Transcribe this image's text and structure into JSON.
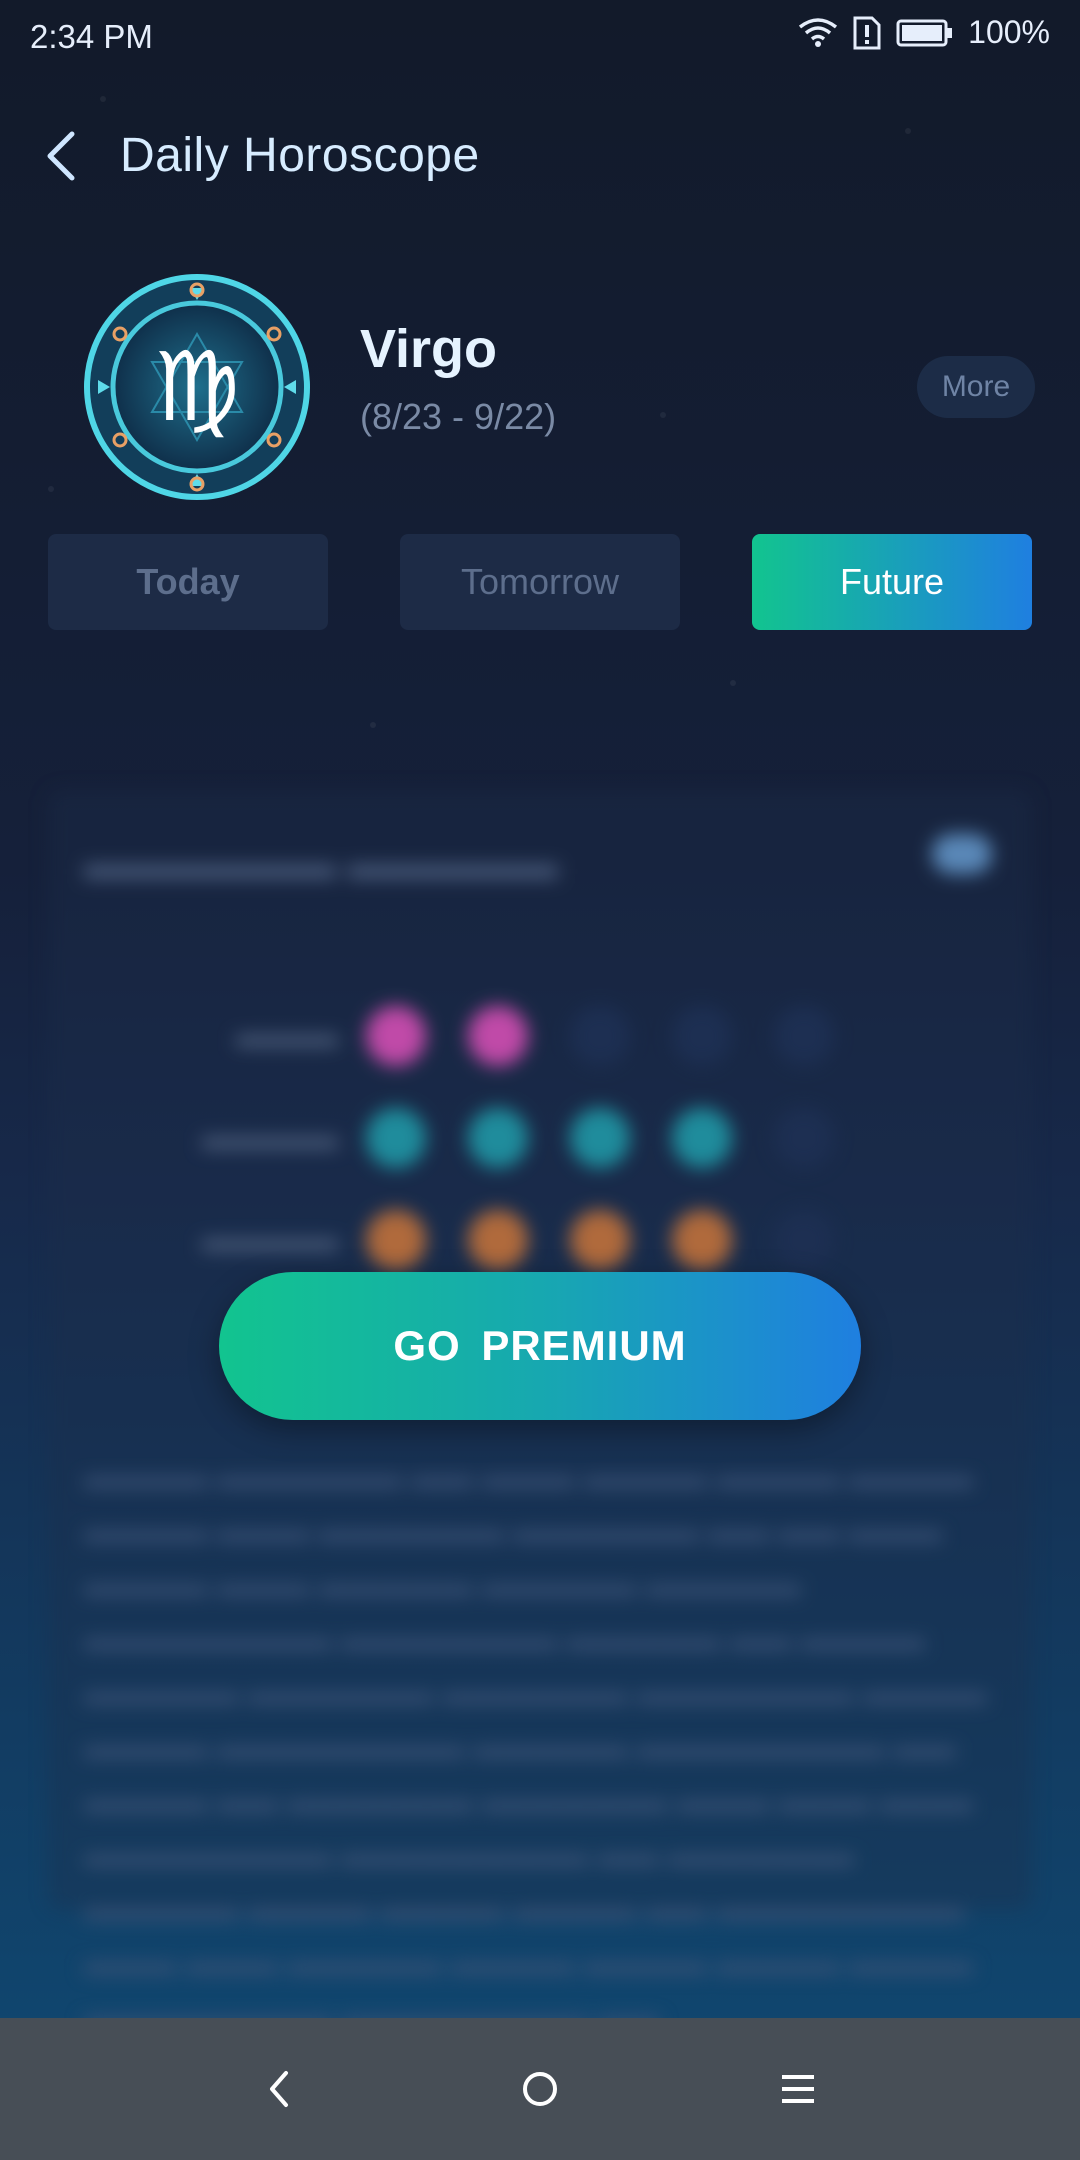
{
  "status_bar": {
    "time": "2:34 PM",
    "battery": "100%"
  },
  "header": {
    "title": "Daily Horoscope"
  },
  "sign": {
    "name": "Virgo",
    "dates": "(8/23 - 9/22)",
    "more_label": "More"
  },
  "tabs": [
    {
      "label": "Today"
    },
    {
      "label": "Tomorrow"
    },
    {
      "label": "Future",
      "selected": true
    }
  ],
  "premium_button": {
    "label": "GO  PREMIUM"
  },
  "colors": {
    "accent_start": "#12c48f",
    "accent_end": "#1f7fe0"
  },
  "icons": {
    "back": "back-arrow-icon",
    "wifi": "wifi-icon",
    "alert": "alert-icon",
    "battery": "battery-icon",
    "sign_emblem": "virgo-zodiac-icon",
    "nav_back": "nav-back-icon",
    "nav_home": "nav-home-icon",
    "nav_menu": "nav-menu-icon"
  }
}
